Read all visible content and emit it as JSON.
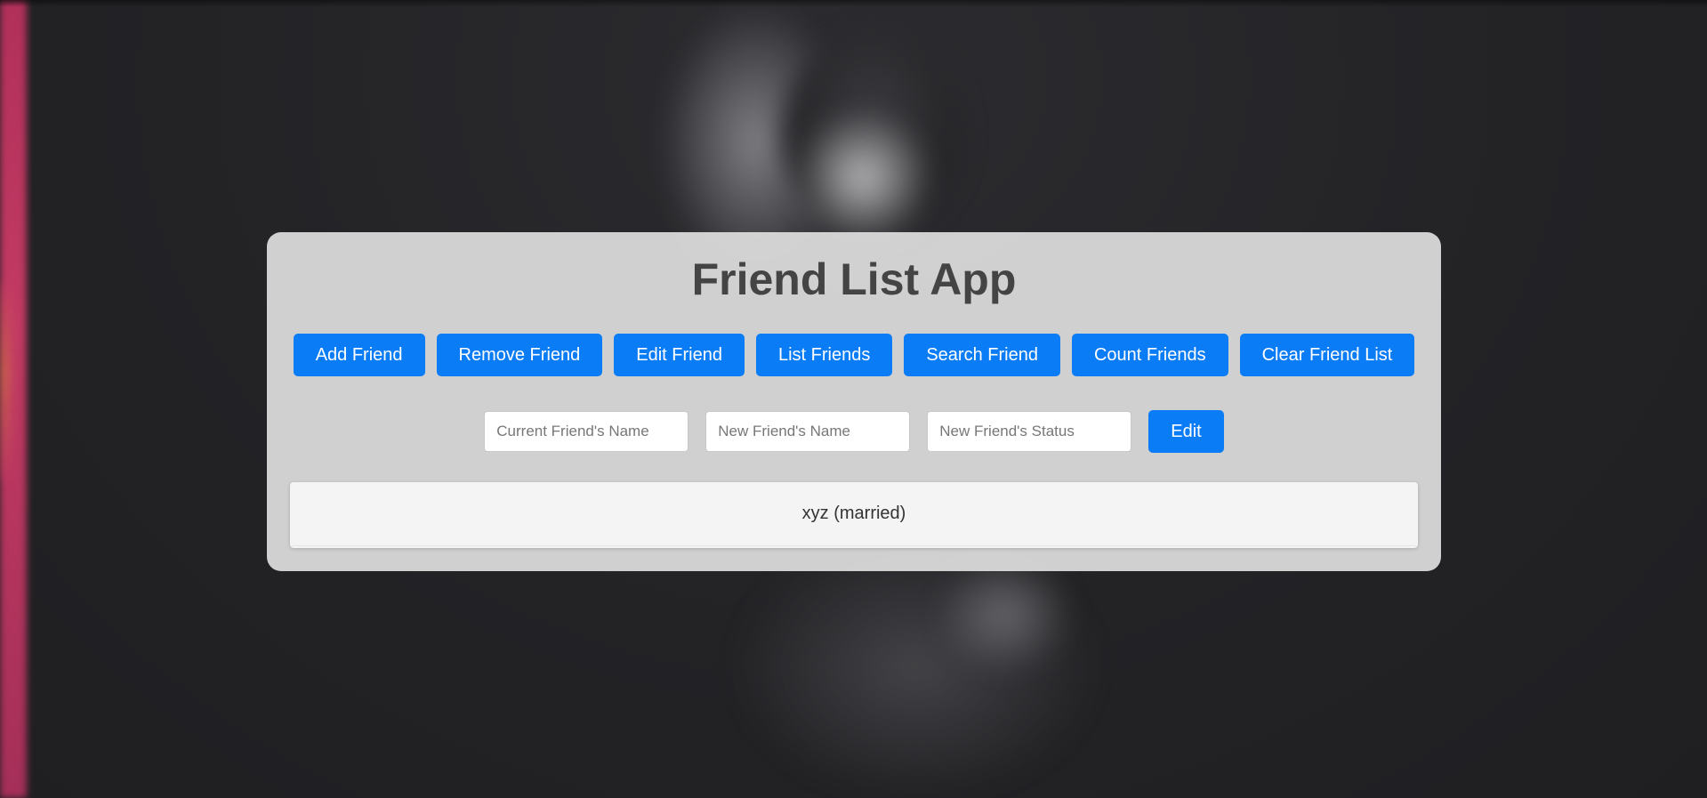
{
  "app": {
    "title": "Friend List App"
  },
  "toolbar": {
    "buttons": [
      {
        "label": "Add Friend"
      },
      {
        "label": "Remove Friend"
      },
      {
        "label": "Edit Friend"
      },
      {
        "label": "List Friends"
      },
      {
        "label": "Search Friend"
      },
      {
        "label": "Count Friends"
      },
      {
        "label": "Clear Friend List"
      }
    ]
  },
  "edit_form": {
    "current_name": {
      "value": "",
      "placeholder": "Current Friend's Name"
    },
    "new_name": {
      "value": "",
      "placeholder": "New Friend's Name"
    },
    "new_status": {
      "value": "",
      "placeholder": "New Friend's Status"
    },
    "submit_label": "Edit"
  },
  "friends": [
    {
      "text": "xyz (married)"
    }
  ],
  "colors": {
    "accent": "#0a7cf5",
    "panel": "#dedede",
    "background": "#232326",
    "side_stripe": "#c23a63"
  }
}
